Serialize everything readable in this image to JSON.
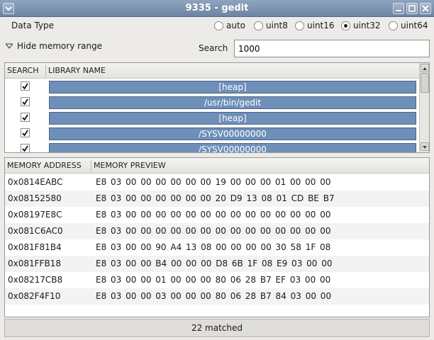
{
  "window": {
    "title": "9335 - gedit"
  },
  "data_type": {
    "label": "Data Type",
    "options": [
      "auto",
      "uint8",
      "uint16",
      "uint32",
      "uint64"
    ],
    "selected": "uint32"
  },
  "memory_range": {
    "toggle_label": "Hide memory range"
  },
  "search": {
    "label": "Search",
    "value": "1000"
  },
  "libraries": {
    "headers": [
      "SEARCH",
      "LIBRARY NAME"
    ],
    "rows": [
      {
        "checked": true,
        "name": "[heap]"
      },
      {
        "checked": true,
        "name": "/usr/bin/gedit"
      },
      {
        "checked": true,
        "name": "[heap]"
      },
      {
        "checked": true,
        "name": "/SYSV00000000"
      },
      {
        "checked": true,
        "name": "/SYSV00000000"
      }
    ]
  },
  "memory": {
    "headers": [
      "MEMORY ADDRESS",
      "MEMORY PREVIEW"
    ],
    "rows": [
      {
        "address": "0x0814EABC",
        "preview": "E8 03 00 00 00 00 00 00 19 00 00 00 01 00 00 00"
      },
      {
        "address": "0x08152580",
        "preview": "E8 03 00 00 00 00 00 00 20 D9 13 08 01 CD BE B7"
      },
      {
        "address": "0x08197E8C",
        "preview": "E8 03 00 00 00 00 00 00 00 00 00 00 00 00 00 00"
      },
      {
        "address": "0x081C6AC0",
        "preview": "E8 03 00 00 00 00 00 00 00 00 00 00 00 00 00 00"
      },
      {
        "address": "0x081F81B4",
        "preview": "E8 03 00 00 90 A4 13 08 00 00 00 00 30 58 1F 08"
      },
      {
        "address": "0x081FFB18",
        "preview": "E8 03 00 00 B4 00 00 00 D8 6B 1F 08 E9 03 00 00"
      },
      {
        "address": "0x08217CB8",
        "preview": "E8 03 00 00 01 00 00 00 80 06 28 B7 EF 03 00 00"
      },
      {
        "address": "0x082F4F10",
        "preview": "E8 03 00 00 03 00 00 00 80 06 28 B7 84 03 00 00"
      }
    ]
  },
  "status": {
    "text": "22 matched"
  },
  "colors": {
    "selection": "#6e8fb8",
    "titlebar": "#7b91ae"
  }
}
